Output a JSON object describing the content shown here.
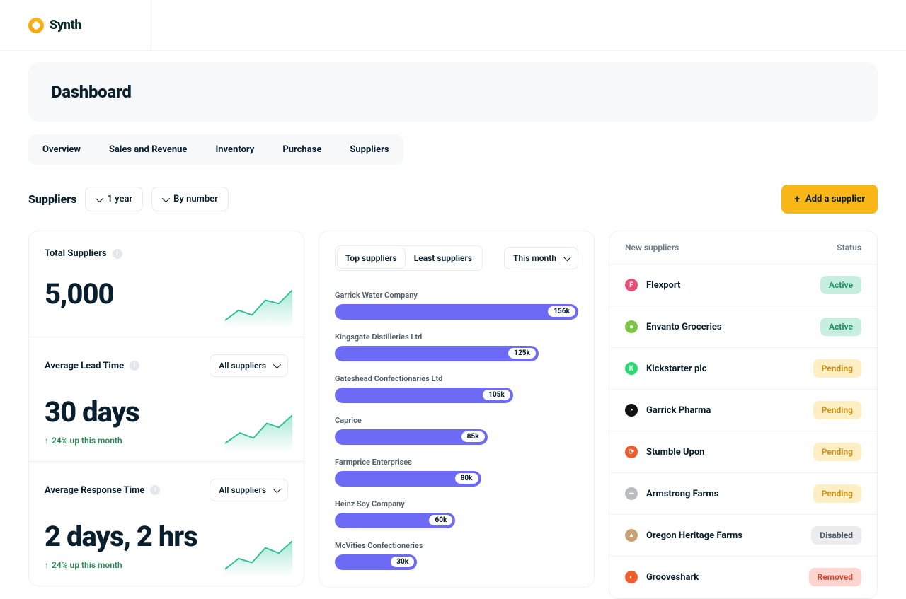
{
  "brand": {
    "name": "Synth"
  },
  "hero": {
    "title": "Dashboard"
  },
  "tabs": [
    "Overview",
    "Sales and Revenue",
    "Inventory",
    "Purchase",
    "Suppliers"
  ],
  "filters": {
    "section_label": "Suppliers",
    "range": "1 year",
    "sort": "By number",
    "add_button": "Add a supplier"
  },
  "stats": {
    "total": {
      "title": "Total Suppliers",
      "value": "5,000"
    },
    "lead": {
      "title": "Average Lead Time",
      "select": "All suppliers",
      "value": "30 days",
      "delta": "24% up this month"
    },
    "resp": {
      "title": "Average Response Time",
      "select": "All suppliers",
      "value": "2 days, 2 hrs",
      "delta": "24% up this month"
    }
  },
  "chart": {
    "seg_top": "Top suppliers",
    "seg_least": "Least suppliers",
    "range_select": "This month"
  },
  "chart_data": {
    "type": "bar",
    "title": "Top suppliers",
    "xlabel": "",
    "ylabel": "",
    "ylim": [
      0,
      160
    ],
    "categories": [
      "Garrick Water Company",
      "Kingsgate Distilleries Ltd",
      "Gateshead Confectionaries Ltd",
      "Caprice",
      "Farmprice Enterprises",
      "Heinz Soy Company",
      "McVities Confectioneries"
    ],
    "labels": [
      "156k",
      "125k",
      "105k",
      "85k",
      "80k",
      "60k",
      "30k"
    ],
    "values": [
      156,
      125,
      105,
      85,
      80,
      60,
      30
    ]
  },
  "suppliers_list": {
    "head_name": "New suppliers",
    "head_status": "Status",
    "rows": [
      {
        "name": "Flexport",
        "status": "Active",
        "status_class": "st-active",
        "color": "#e94f74",
        "glyph": "F"
      },
      {
        "name": "Envanto Groceries",
        "status": "Active",
        "status_class": "st-active",
        "color": "#7cc544",
        "glyph": "●"
      },
      {
        "name": "Kickstarter plc",
        "status": "Pending",
        "status_class": "st-pending",
        "color": "#2bd970",
        "glyph": "K"
      },
      {
        "name": "Garrick Pharma",
        "status": "Pending",
        "status_class": "st-pending",
        "color": "#111",
        "glyph": "◔"
      },
      {
        "name": "Stumble Upon",
        "status": "Pending",
        "status_class": "st-pending",
        "color": "#ef5a2e",
        "glyph": "⟳"
      },
      {
        "name": "Armstrong Farms",
        "status": "Pending",
        "status_class": "st-pending",
        "color": "#b9bcc1",
        "glyph": "—"
      },
      {
        "name": "Oregon Heritage Farms",
        "status": "Disabled",
        "status_class": "st-disabled",
        "color": "#c9a173",
        "glyph": "▲"
      },
      {
        "name": "Grooveshark",
        "status": "Removed",
        "status_class": "st-removed",
        "color": "#f25b2a",
        "glyph": "◐"
      }
    ]
  }
}
